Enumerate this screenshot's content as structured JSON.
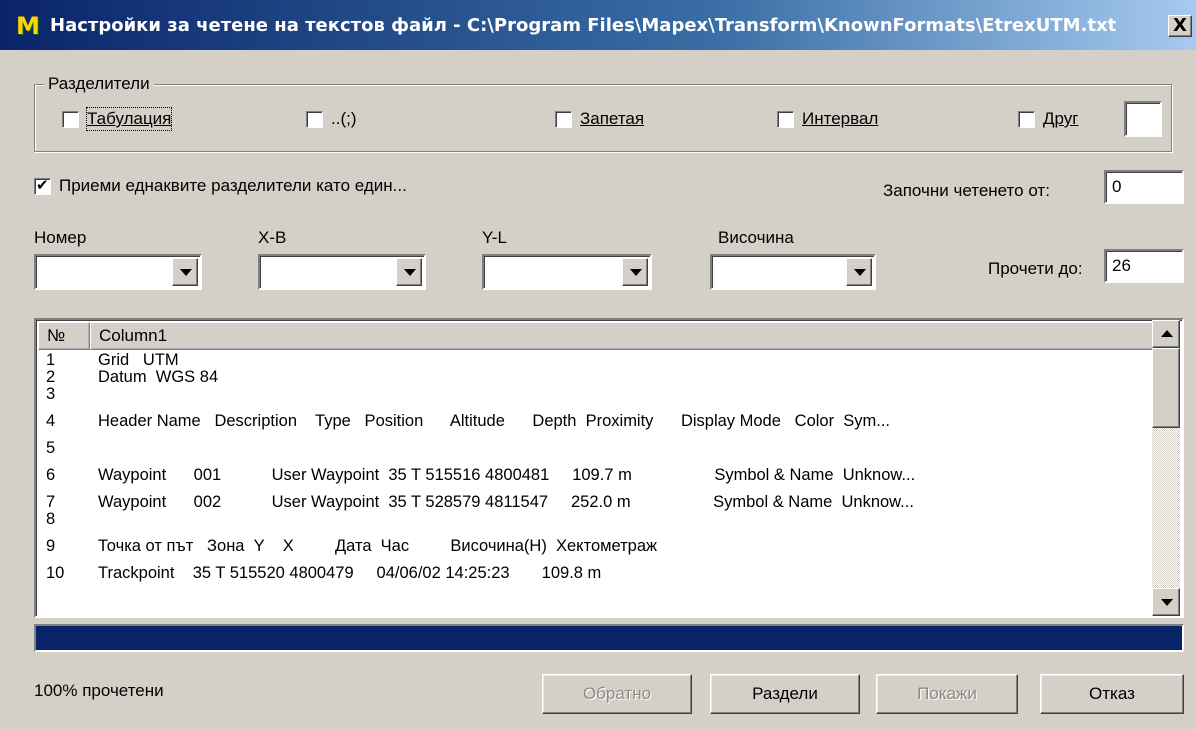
{
  "window": {
    "logo": "М",
    "title": "Настройки за четене на текстов файл - C:\\Program Files\\Mapex\\Transform\\KnownFormats\\EtrexUTM.txt",
    "close": "X"
  },
  "separators": {
    "legend": "Разделители",
    "tab": "Табулация",
    "semicolon": "..(;)",
    "comma": "Запетая",
    "space": "Интервал",
    "other": "Друг",
    "other_value": ""
  },
  "options": {
    "merge_label": "Приеми еднаквите разделители като един...",
    "merge_checked": true,
    "start_label": "Започни четенето от:",
    "start_value": "0",
    "end_label": "Прочети до:",
    "end_value": "26"
  },
  "columns": {
    "number": "Номер",
    "xb": "X-B",
    "yl": "Y-L",
    "height": "Височина"
  },
  "list": {
    "headers": [
      "№",
      "Column1"
    ],
    "rows": [
      {
        "n": "1",
        "text": "Grid   UTM"
      },
      {
        "n": "2",
        "text": "Datum  WGS 84"
      },
      {
        "n": "3",
        "text": ""
      },
      {
        "n": "4",
        "text": "Header Name   Description    Type   Position      Altitude      Depth  Proximity      Display Mode   Color  Sym..."
      },
      {
        "n": "5",
        "text": ""
      },
      {
        "n": "6",
        "text": "Waypoint      001           User Waypoint  35 T 515516 4800481     109.7 m                  Symbol & Name  Unknow..."
      },
      {
        "n": "7",
        "text": "Waypoint      002           User Waypoint  35 T 528579 4811547     252.0 m                  Symbol & Name  Unknow..."
      },
      {
        "n": "8",
        "text": ""
      },
      {
        "n": "9",
        "text": "Точка от път   Зона  Y    X         Дата  Час         Височина(H)  Хектометраж"
      },
      {
        "n": "10",
        "text": "Trackpoint    35 T 515520 4800479     04/06/02 14:25:23       109.8 m"
      }
    ]
  },
  "progress": {
    "percent": 100,
    "status": "100% прочетени"
  },
  "buttons": {
    "back": "Обратно",
    "split": "Раздели",
    "show": "Покажи",
    "cancel": "Отказ"
  }
}
